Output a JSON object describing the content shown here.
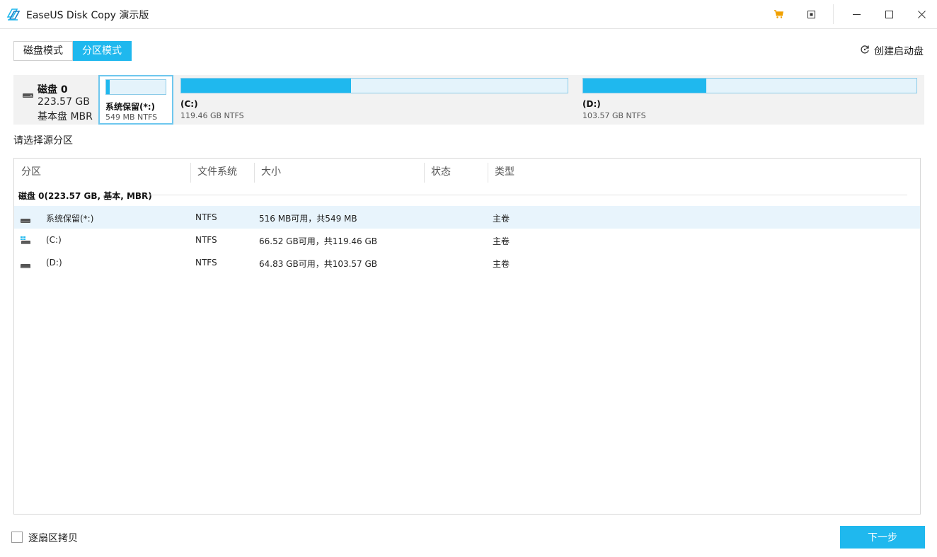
{
  "window": {
    "title": "EaseUS Disk Copy 演示版",
    "icons": {
      "logo": "easeus-logo-icon",
      "cart": "cart-icon",
      "pin": "pin-icon",
      "minimize": "minimize-icon",
      "maximize": "maximize-icon",
      "close": "close-icon"
    },
    "colors": {
      "accent": "#1fb8ee",
      "cart": "#f0a000"
    }
  },
  "modes": {
    "disk": "磁盘模式",
    "partition": "分区模式",
    "active": "partition"
  },
  "create_boot": {
    "label": "创建启动盘",
    "icon": "refresh-disk-icon"
  },
  "disk_map": {
    "disk": {
      "name": "磁盘 0",
      "size": "223.57 GB",
      "type": "基本盘 MBR",
      "icon": "hdd-icon"
    },
    "partitions": [
      {
        "label": "系统保留(*:)",
        "meta": "549 MB NTFS",
        "used_fraction": 0.06,
        "selected": true
      },
      {
        "label": "(C:)",
        "meta": "119.46 GB NTFS",
        "used_fraction": 0.44,
        "selected": false
      },
      {
        "label": "(D:)",
        "meta": "103.57 GB NTFS",
        "used_fraction": 0.37,
        "selected": false
      }
    ]
  },
  "prompt": "请选择源分区",
  "table": {
    "columns": [
      "分区",
      "文件系统",
      "大小",
      "状态",
      "类型"
    ],
    "group": "磁盘 0(223.57 GB, 基本, MBR)",
    "rows": [
      {
        "name": "系统保留(*:)",
        "fs": "NTFS",
        "size": "516 MB可用，共549 MB",
        "status": "",
        "type": "主卷",
        "icon": "drive-icon",
        "selected": true
      },
      {
        "name": "(C:)",
        "fs": "NTFS",
        "size": "66.52 GB可用，共119.46 GB",
        "status": "",
        "type": "主卷",
        "icon": "windows-drive-icon",
        "selected": false
      },
      {
        "name": "(D:)",
        "fs": "NTFS",
        "size": "64.83 GB可用，共103.57 GB",
        "status": "",
        "type": "主卷",
        "icon": "drive-icon",
        "selected": false
      }
    ]
  },
  "footer": {
    "sector_copy_label": "逐扇区拷贝",
    "sector_copy_checked": false,
    "next_label": "下一步"
  }
}
